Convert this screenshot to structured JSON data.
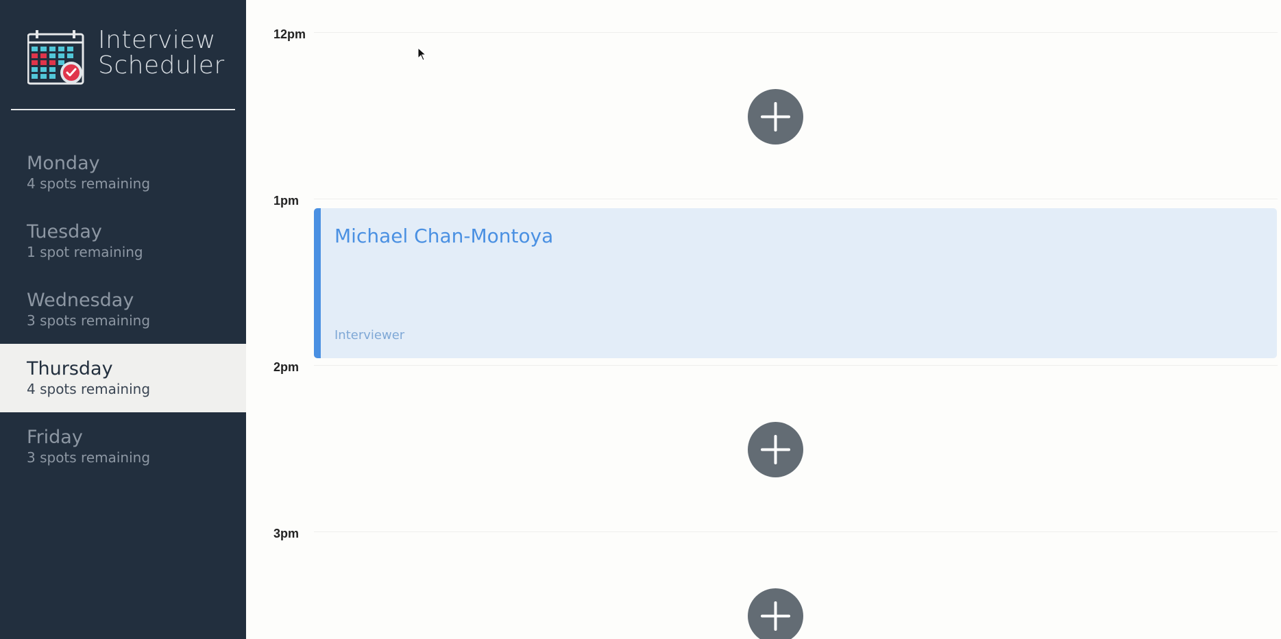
{
  "app": {
    "title_line1": "Interview",
    "title_line2": "Scheduler"
  },
  "days": [
    {
      "name": "Monday",
      "spots": "4 spots remaining",
      "selected": false
    },
    {
      "name": "Tuesday",
      "spots": "1 spot remaining",
      "selected": false
    },
    {
      "name": "Wednesday",
      "spots": "3 spots remaining",
      "selected": false
    },
    {
      "name": "Thursday",
      "spots": "4 spots remaining",
      "selected": true
    },
    {
      "name": "Friday",
      "spots": "3 spots remaining",
      "selected": false
    }
  ],
  "schedule": {
    "slots": [
      {
        "time": "12pm",
        "state": "empty"
      },
      {
        "time": "1pm",
        "state": "booked",
        "student": "Michael Chan-Montoya",
        "interviewer_label": "Interviewer"
      },
      {
        "time": "2pm",
        "state": "empty"
      },
      {
        "time": "3pm",
        "state": "empty"
      }
    ]
  },
  "icons": {
    "logo": "calendar-check-icon",
    "add": "plus-icon"
  },
  "colors": {
    "sidebar_bg": "#222f3e",
    "selected_bg": "#f0f0ee",
    "accent": "#4a90e2",
    "appointment_bg": "#e3edf8",
    "add_button": "#636c74"
  }
}
